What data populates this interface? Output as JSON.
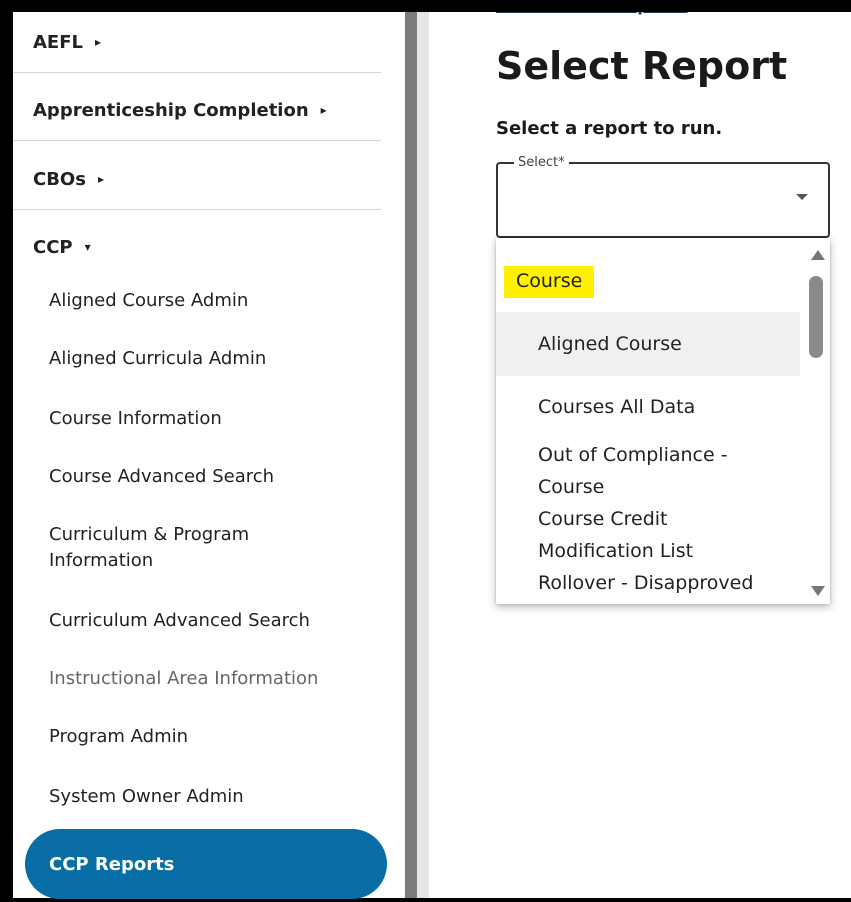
{
  "sidebar": {
    "top_items": [
      {
        "label": "AEFL",
        "caret": "▸"
      },
      {
        "label": "Apprenticeship Completion",
        "caret": "▸"
      },
      {
        "label": "CBOs",
        "caret": "▸"
      },
      {
        "label": "CCP",
        "caret": "▾"
      }
    ],
    "ccp_items": [
      "Aligned Course Admin",
      "Aligned Curricula Admin",
      "Course Information",
      "Course Advanced Search",
      "Curriculum & Program Information",
      "Curriculum Advanced Search",
      "Instructional Area Information",
      "Program Admin",
      "System Owner Admin"
    ],
    "active_item": "CCP Reports"
  },
  "main": {
    "breadcrumb": "Home / CCP Reports",
    "title": "Select Report",
    "subtitle": "Select a report to run.",
    "select": {
      "label": "Select*",
      "value": ""
    }
  },
  "dropdown": {
    "group_label": "Course",
    "options": [
      "Aligned Course",
      "Courses All Data",
      "Out of Compliance - Course",
      "Course Credit",
      "Modification List",
      "Rollover - Disapproved"
    ]
  },
  "colors": {
    "active_nav": "#0a6ea6",
    "highlight": "#fff100"
  }
}
